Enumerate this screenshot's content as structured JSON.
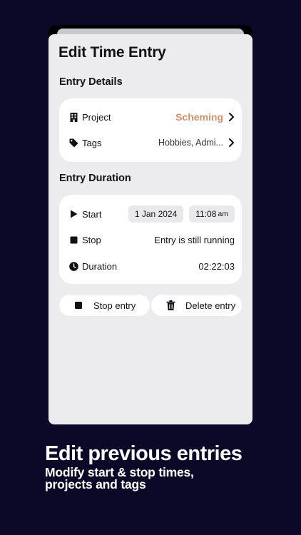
{
  "sheet": {
    "title": "Edit Time Entry"
  },
  "details": {
    "section_title": "Entry Details",
    "project": {
      "label": "Project",
      "value": "Scheming",
      "icon": "building-icon",
      "accent": "#d4916a"
    },
    "tags": {
      "label": "Tags",
      "value": "Hobbies, Admi...",
      "icon": "tag-icon"
    }
  },
  "duration": {
    "section_title": "Entry Duration",
    "start": {
      "label": "Start",
      "date": "1 Jan 2024",
      "time": "11:08",
      "ampm": "am",
      "icon": "play-icon"
    },
    "stop": {
      "label": "Stop",
      "value": "Entry is still running",
      "icon": "stop-icon"
    },
    "total": {
      "label": "Duration",
      "value": "02:22:03",
      "icon": "clock-icon"
    }
  },
  "actions": {
    "stop_label": "Stop entry",
    "delete_label": "Delete entry"
  },
  "caption": {
    "title": "Edit previous entries",
    "subtitle": "Modify start & stop times, projects and tags"
  },
  "colors": {
    "background": "#0b0828",
    "sheet": "#ececee",
    "card": "#ffffff",
    "pill": "#e9e9ec"
  }
}
